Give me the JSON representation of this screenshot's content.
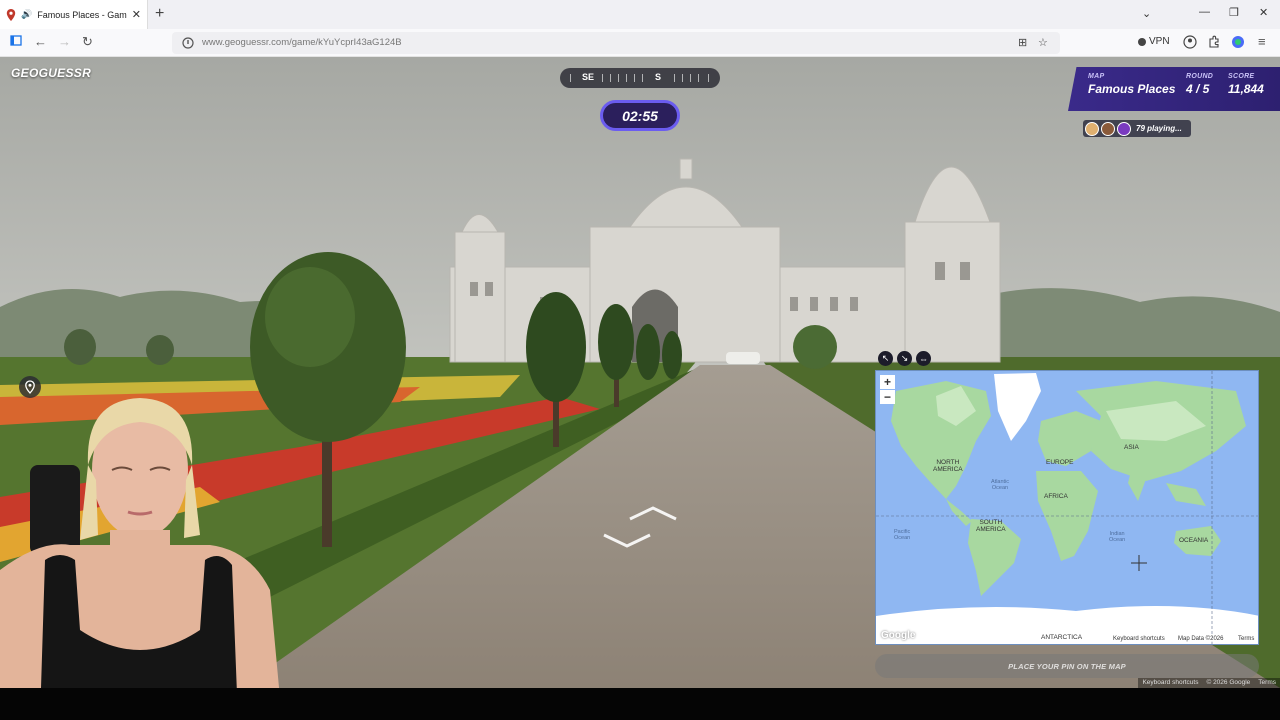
{
  "browser": {
    "tab_title": "Famous Places - Game - Ge",
    "url": "www.geoguessr.com/game/kYuYcprI43aG124B",
    "vpn_label": "VPN"
  },
  "game": {
    "logo_text": "GEOGUESSR",
    "compass": {
      "left": "SE",
      "right": "S"
    },
    "timer": "02:55",
    "status": {
      "map_label": "MAP",
      "map_value": "Famous Places",
      "round_label": "ROUND",
      "round_value": "4 / 5",
      "score_label": "SCORE",
      "score_value": "11,844"
    },
    "players_text": "79 playing...",
    "guess_button": "PLACE YOUR PIN ON THE MAP",
    "footer": [
      "Keyboard shortcuts",
      "© 2026 Google",
      "Terms"
    ]
  },
  "minimap": {
    "continents": [
      {
        "name": "NORTH AMERICA",
        "text": "NORTH\nAMERICA"
      },
      {
        "name": "EUROPE",
        "text": "EUROPE"
      },
      {
        "name": "ASIA",
        "text": "ASIA"
      },
      {
        "name": "AFRICA",
        "text": "AFRICA"
      },
      {
        "name": "SOUTH AMERICA",
        "text": "SOUTH\nAMERICA"
      },
      {
        "name": "OCEANIA",
        "text": "OCEANIA"
      },
      {
        "name": "ANTARCTICA",
        "text": "ANTARCTICA"
      }
    ],
    "oceans": {
      "atlantic": "Atlantic\nOcean",
      "pacific": "Pacific\nOcean",
      "indian": "Indian\nOcean"
    },
    "google_logo": "Google",
    "footer": [
      "Keyboard shortcuts",
      "Map Data ©2026",
      "Terms"
    ],
    "zoom_in": "+",
    "zoom_out": "−"
  },
  "colors": {
    "accent": "#6b5cf0",
    "status_bg": "#3a2a8a",
    "map_water": "#8fb7f2",
    "map_land": "#a8d8a0"
  }
}
